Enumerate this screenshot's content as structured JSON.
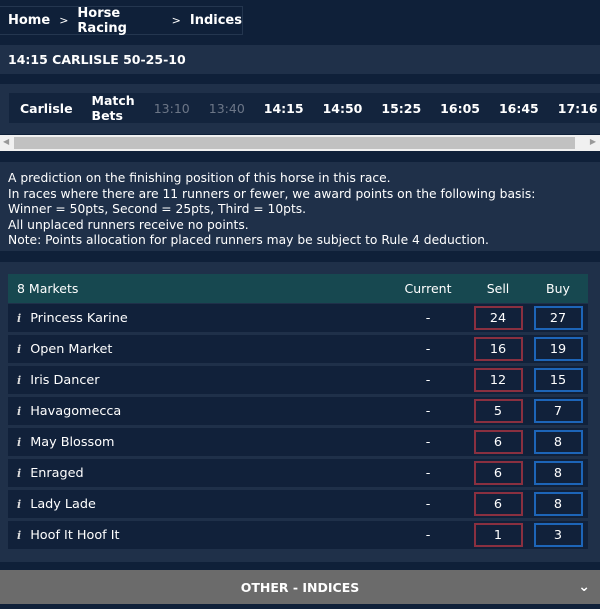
{
  "breadcrumb": [
    "Home",
    "Horse Racing",
    "Indices"
  ],
  "breadcrumb_sep": ">",
  "event_title": "14:15 CARLISLE 50-25-10",
  "nav": [
    {
      "label": "Carlisle",
      "disabled": false
    },
    {
      "label": "Match Bets",
      "disabled": false
    },
    {
      "label": "13:10",
      "disabled": true
    },
    {
      "label": "13:40",
      "disabled": true
    },
    {
      "label": "14:15",
      "disabled": false
    },
    {
      "label": "14:50",
      "disabled": false
    },
    {
      "label": "15:25",
      "disabled": false
    },
    {
      "label": "16:05",
      "disabled": false
    },
    {
      "label": "16:45",
      "disabled": false
    },
    {
      "label": "17:16",
      "disabled": false
    }
  ],
  "description": [
    "A prediction on the finishing position of this horse in this race.",
    "In races where there are 11 runners or fewer, we award points on the following basis:",
    "Winner = 50pts, Second = 25pts, Third = 10pts.",
    "All unplaced runners receive no points.",
    "Note: Points allocation for placed runners may be subject to Rule 4 deduction."
  ],
  "table": {
    "header": {
      "markets": "8 Markets",
      "current": "Current",
      "sell": "Sell",
      "buy": "Buy"
    },
    "rows": [
      {
        "name": "Princess Karine",
        "current": "-",
        "sell": "24",
        "buy": "27"
      },
      {
        "name": "Open Market",
        "current": "-",
        "sell": "16",
        "buy": "19"
      },
      {
        "name": "Iris Dancer",
        "current": "-",
        "sell": "12",
        "buy": "15"
      },
      {
        "name": "Havagomecca",
        "current": "-",
        "sell": "5",
        "buy": "7"
      },
      {
        "name": "May Blossom",
        "current": "-",
        "sell": "6",
        "buy": "8"
      },
      {
        "name": "Enraged",
        "current": "-",
        "sell": "6",
        "buy": "8"
      },
      {
        "name": "Lady Lade",
        "current": "-",
        "sell": "6",
        "buy": "8"
      },
      {
        "name": "Hoof It Hoof It",
        "current": "-",
        "sell": "1",
        "buy": "3"
      }
    ]
  },
  "info_glyph": "i",
  "other_section": "OTHER - INDICES",
  "colors": {
    "sell_border": "#8a3040",
    "buy_border": "#1d65b8",
    "header_bg": "#174850"
  }
}
